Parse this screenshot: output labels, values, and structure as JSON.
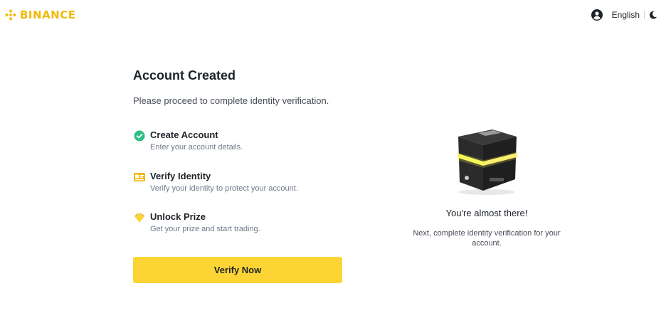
{
  "header": {
    "brand": "BINANCE",
    "language": "English",
    "brand_color": "#f0b90b"
  },
  "main": {
    "title": "Account Created",
    "subtitle": "Please proceed to complete identity verification.",
    "steps": [
      {
        "name": "Create Account",
        "desc": "Enter your account details.",
        "icon": "check-circle-icon",
        "status": "completed"
      },
      {
        "name": "Verify Identity",
        "desc": "Verify your identity to protect your account.",
        "icon": "id-card-icon",
        "status": "pending"
      },
      {
        "name": "Unlock Prize",
        "desc": "Get your prize and start trading.",
        "icon": "diamond-icon",
        "status": "pending"
      }
    ],
    "button_label": "Verify Now",
    "button_color": "#fcd535"
  },
  "side": {
    "title": "You're almost there!",
    "desc": "Next, complete identity verification for your account.",
    "illustration": "mystery-box-illustration"
  }
}
